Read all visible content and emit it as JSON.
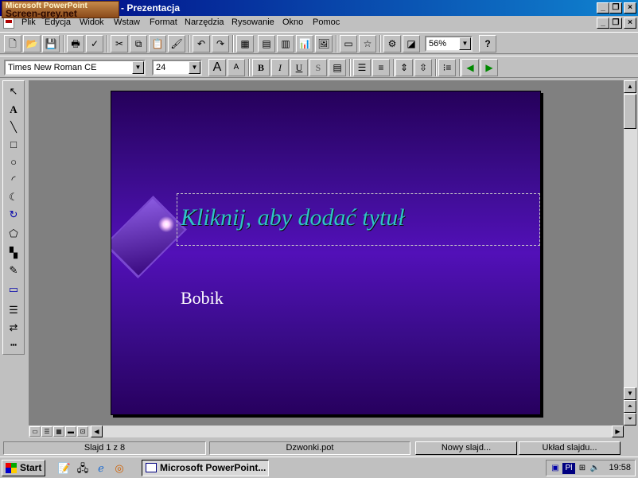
{
  "app": {
    "logo_text_top": "Microsoft PowerPoint",
    "logo_text_big": "Screen-grey.net",
    "title": "- Prezentacja"
  },
  "menu": [
    "Plik",
    "Edycja",
    "Widok",
    "Wstaw",
    "Format",
    "Narzędzia",
    "Rysowanie",
    "Okno",
    "Pomoc"
  ],
  "toolbar": {
    "zoom": "56%",
    "font": "Times New Roman CE",
    "size": "24",
    "help_icon": "?",
    "bold": "B",
    "italic": "I",
    "underline": "U",
    "shadow": "S",
    "font_grow": "A",
    "font_shrink": "A"
  },
  "slide": {
    "title_placeholder": "Kliknij, aby dodać tytuł",
    "subtitle": "Bobik"
  },
  "status": {
    "slide": "Slajd 1 z 8",
    "template": "Dzwonki.pot",
    "new_slide": "Nowy slajd...",
    "layout": "Układ slajdu..."
  },
  "taskbar": {
    "start": "Start",
    "task": "Microsoft PowerPoint...",
    "lang": "Pl",
    "clock": "19:58"
  },
  "colors": {
    "title_text": "#2fc3c8",
    "titlebar": "#000080"
  }
}
